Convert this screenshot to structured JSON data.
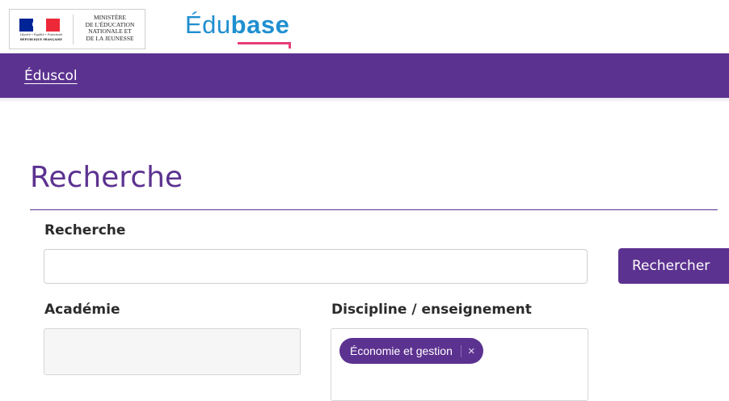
{
  "header": {
    "ministry": {
      "line1": "MINISTÈRE",
      "line2": "DE L'ÉDUCATION",
      "line3": "NATIONALE ET",
      "line4": "DE LA JEUNESSE",
      "motto": "Liberté • Égalité • Fraternité",
      "republic": "RÉPUBLIQUE FRANÇAISE"
    },
    "brand": {
      "part1": "Édu",
      "part2": "base"
    },
    "colors": {
      "flag_blue": "#002395",
      "flag_white": "#ffffff",
      "flag_red": "#ed2939",
      "brand_blue": "#1f8fd0",
      "brand_pink": "#e83e78"
    }
  },
  "nav": {
    "link_label": "Éduscol",
    "color": "#5c3290"
  },
  "main": {
    "title": "Recherche",
    "search": {
      "label": "Recherche",
      "value": "",
      "placeholder": "",
      "button_label": "Rechercher"
    },
    "academie": {
      "label": "Académie",
      "selected": []
    },
    "discipline": {
      "label": "Discipline / enseignement",
      "selected_tags": [
        {
          "label": "Économie et gestion",
          "remove_icon": "×"
        }
      ]
    }
  }
}
